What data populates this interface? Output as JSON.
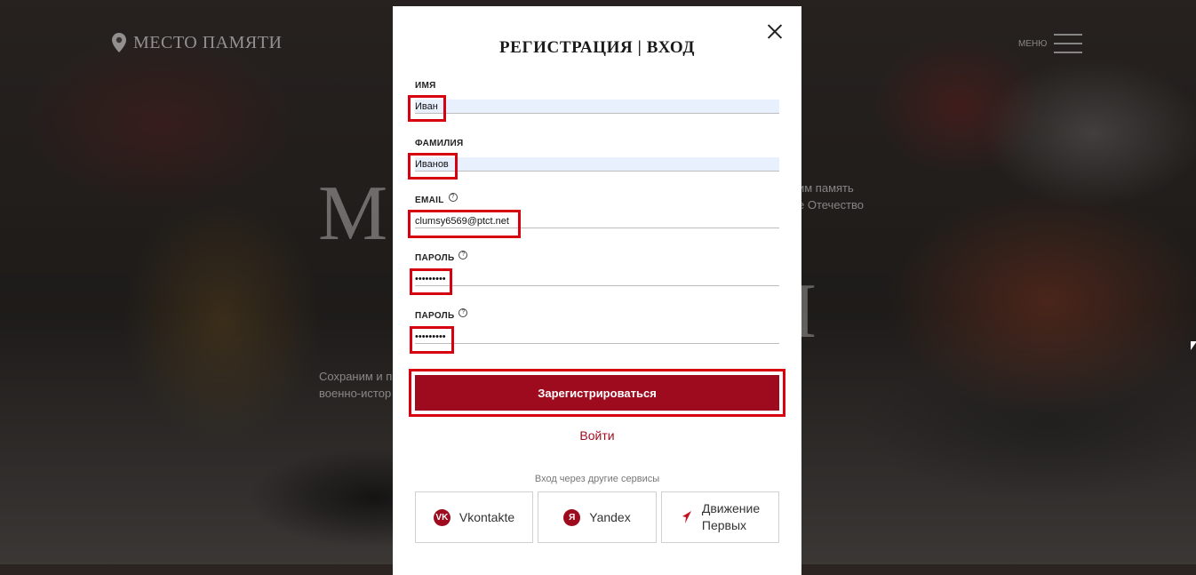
{
  "background": {
    "site_title": "МЕСТО ПАМЯТИ",
    "menu_label": "МЕНЮ",
    "hero_left_letter": "М",
    "hero_right_letter": "I",
    "hero_right_text_line1": "им память",
    "hero_right_text_line2": "е Отечество",
    "hero_left_text_line1": "Сохраним и п",
    "hero_left_text_line2": "военно-истор"
  },
  "modal": {
    "title": "РЕГИСТРАЦИЯ | ВХОД",
    "fields": [
      {
        "label": "ИМЯ",
        "value": "Иван",
        "has_help": false
      },
      {
        "label": "ФАМИЛИЯ",
        "value": "Иванов",
        "has_help": false
      },
      {
        "label": "EMAIL",
        "value": "clumsy6569@ptct.net",
        "has_help": true
      },
      {
        "label": "ПАРОЛЬ",
        "value": "•••••••••",
        "has_help": true
      },
      {
        "label": "ПАРОЛЬ",
        "value": "•••••••••",
        "has_help": true
      }
    ],
    "help_glyph": "?",
    "submit_label": "Зарегистрироваться",
    "login_link": "Войти",
    "other_services_label": "Вход через другие сервисы",
    "services": [
      {
        "label": "Vkontakte",
        "icon": "vk-icon",
        "icon_text": "VK"
      },
      {
        "label": "Yandex",
        "icon": "yandex-icon",
        "icon_text": "Я"
      },
      {
        "label_line1": "Движение",
        "label_line2": "Первых",
        "icon": "arrow-icon"
      }
    ]
  },
  "colors": {
    "accent": "#9e0b1f",
    "highlight": "#d7000f",
    "autofill": "#e8f0fe"
  }
}
